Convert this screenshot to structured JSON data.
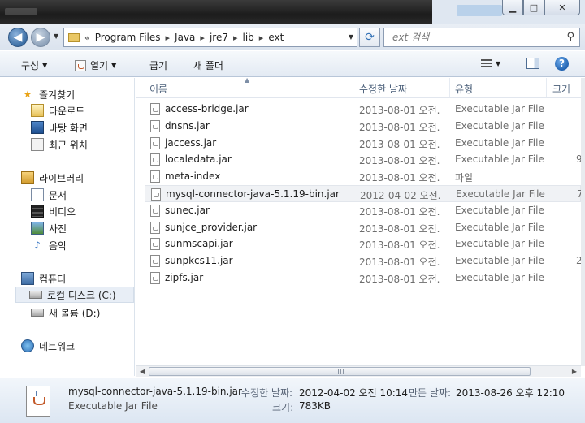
{
  "window": {
    "caption_buttons": {
      "minimize": "▁",
      "maximize": "□",
      "close": "✕"
    }
  },
  "address_bar": {
    "overflow": "«",
    "crumbs": [
      "Program Files",
      "Java",
      "jre7",
      "lib",
      "ext"
    ],
    "separator": "▸"
  },
  "search": {
    "placeholder": "ext 검색"
  },
  "commands": {
    "organize": "구성",
    "open": "열기",
    "burn": "굽기",
    "new_folder": "새 폴더"
  },
  "sidebar": {
    "favorites": {
      "label": "즐겨찾기",
      "items": [
        "다운로드",
        "바탕 화면",
        "최근 위치"
      ]
    },
    "libraries": {
      "label": "라이브러리",
      "items": [
        "문서",
        "비디오",
        "사진",
        "음악"
      ]
    },
    "computer": {
      "label": "컴퓨터",
      "items": [
        "로컬 디스크 (C:)",
        "새 볼륨 (D:)"
      ]
    },
    "network": {
      "label": "네트워크"
    }
  },
  "columns": {
    "name": "이름",
    "date": "수정한 날짜",
    "type": "유형",
    "size": "크기"
  },
  "files": [
    {
      "name": "access-bridge.jar",
      "date": "2013-08-01 오전...",
      "type": "Executable Jar File",
      "size": ""
    },
    {
      "name": "dnsns.jar",
      "date": "2013-08-01 오전...",
      "type": "Executable Jar File",
      "size": ""
    },
    {
      "name": "jaccess.jar",
      "date": "2013-08-01 오전...",
      "type": "Executable Jar File",
      "size": ""
    },
    {
      "name": "localedata.jar",
      "date": "2013-08-01 오전...",
      "type": "Executable Jar File",
      "size": "9"
    },
    {
      "name": "meta-index",
      "date": "2013-08-01 오전...",
      "type": "파일",
      "size": ""
    },
    {
      "name": "mysql-connector-java-5.1.19-bin.jar",
      "date": "2012-04-02 오전...",
      "type": "Executable Jar File",
      "size": "7"
    },
    {
      "name": "sunec.jar",
      "date": "2013-08-01 오전...",
      "type": "Executable Jar File",
      "size": ""
    },
    {
      "name": "sunjce_provider.jar",
      "date": "2013-08-01 오전...",
      "type": "Executable Jar File",
      "size": ""
    },
    {
      "name": "sunmscapi.jar",
      "date": "2013-08-01 오전...",
      "type": "Executable Jar File",
      "size": ""
    },
    {
      "name": "sunpkcs11.jar",
      "date": "2013-08-01 오전...",
      "type": "Executable Jar File",
      "size": "2"
    },
    {
      "name": "zipfs.jar",
      "date": "2013-08-01 오전...",
      "type": "Executable Jar File",
      "size": ""
    }
  ],
  "selected_index": 5,
  "details": {
    "name": "mysql-connector-java-5.1.19-bin.jar",
    "kind": "Executable Jar File",
    "modified_label": "수정한 날짜:",
    "modified_value": "2012-04-02 오전 10:14",
    "created_label": "만든 날짜:",
    "created_value": "2013-08-26 오후 12:10",
    "size_label": "크기:",
    "size_value": "783KB"
  },
  "icons": {
    "back": "back-arrow-icon",
    "forward": "forward-arrow-icon",
    "refresh": "refresh-icon",
    "search": "magnifier-icon",
    "help": "help-icon",
    "jar": "java-jar-file-icon"
  },
  "colors": {
    "accent": "#3d6fa5",
    "selection": "#f0f2f5",
    "folder": "#e9c765"
  }
}
